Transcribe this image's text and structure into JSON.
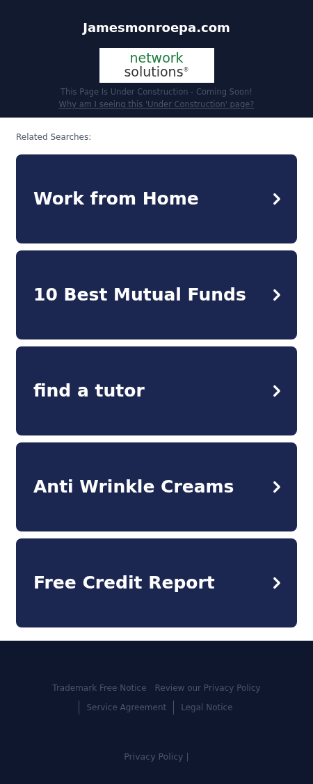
{
  "header": {
    "title": "Jamesmonroepa.com",
    "logo": {
      "line1": "network",
      "line2": "solutions",
      "mark": "®"
    },
    "notice": "This Page Is Under Construction - Coming Soon!",
    "notice_link": "Why am I seeing this 'Under Construction' page?"
  },
  "related": {
    "heading": "Related Searches:",
    "items": [
      {
        "label": "Work from Home"
      },
      {
        "label": "10 Best Mutual Funds"
      },
      {
        "label": "find a tutor"
      },
      {
        "label": "Anti Wrinkle Creams"
      },
      {
        "label": "Free Credit Report"
      }
    ]
  },
  "footer": {
    "links": [
      {
        "label": "Trademark Free Notice",
        "divider": false
      },
      {
        "label": "Review our Privacy Policy",
        "divider": false
      },
      {
        "label": "Service Agreement",
        "divider": true
      },
      {
        "label": "Legal Notice",
        "divider": true
      }
    ],
    "bottom_link": "Privacy Policy",
    "bottom_separator": "|"
  }
}
